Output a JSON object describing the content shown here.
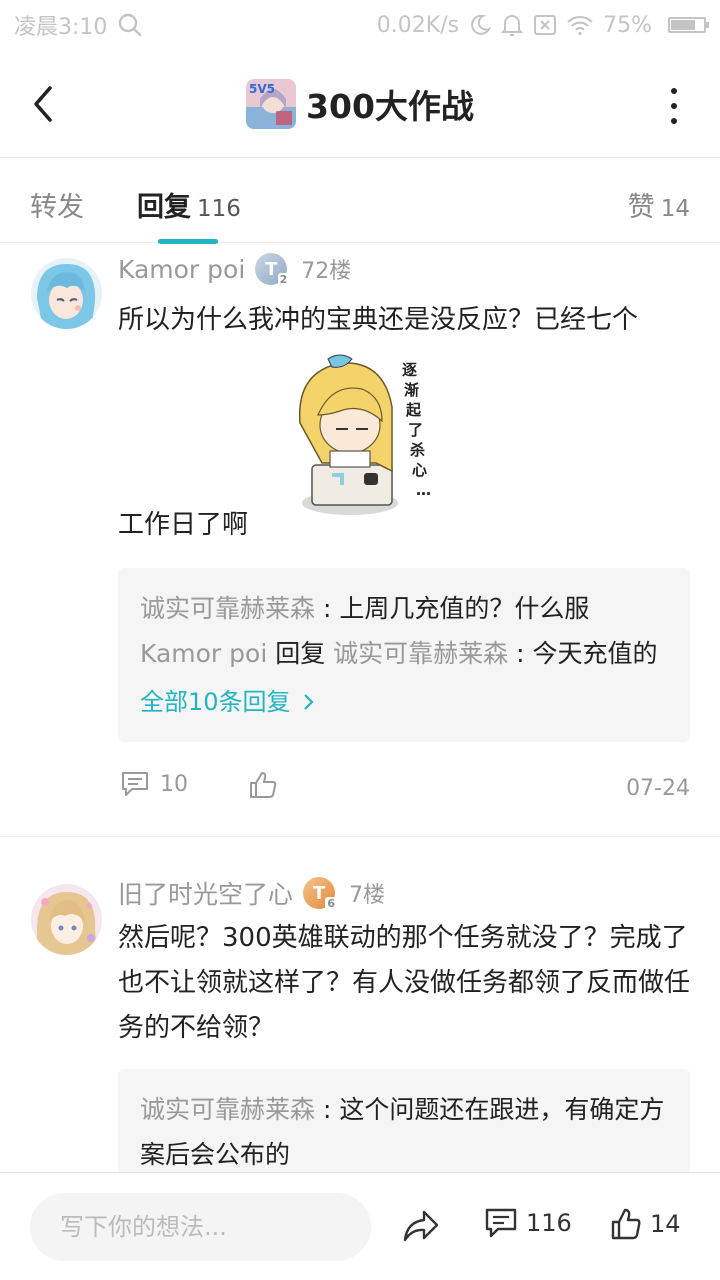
{
  "status_bar": {
    "time": "凌晨3:10",
    "speed": "0.02K/s",
    "battery": "75%",
    "battery_level": 0.75
  },
  "header": {
    "title": "300大作战",
    "game_icon_text": "5V5",
    "icons": [
      "back-arrow-icon",
      "more-vertical-icon"
    ]
  },
  "tabs": {
    "forward_label": "转发",
    "reply_label": "回复",
    "reply_count": "116",
    "like_label": "赞",
    "like_count": "14"
  },
  "comments": [
    {
      "username": "Kamor poi",
      "level_letter": "T",
      "level_num": "2",
      "floor": "72楼",
      "text_before_sticker": "所以为什么我冲的宝典还是没反应？已经七个",
      "text_after_sticker": "工作日了啊",
      "sticker_text": [
        "逐",
        "渐",
        "起",
        "了",
        "杀",
        "心",
        "…"
      ],
      "replies": [
        {
          "user": "诚实可靠赫莱森",
          "sep": " : ",
          "text": "上周几充值的？什么服"
        },
        {
          "user": "Kamor poi",
          "mid": " 回复 ",
          "target": "诚实可靠赫莱森",
          "sep": " : ",
          "text": "今天充值的"
        }
      ],
      "view_all": "全部10条回复",
      "comment_count": "10",
      "date": "07-24"
    },
    {
      "username": "旧了时光空了心",
      "level_letter": "T",
      "level_num": "6",
      "floor": "7楼",
      "text": "然后呢？300英雄联动的那个任务就没了？完成了也不让领就这样了？有人没做任务都领了反而做任务的不给领？",
      "replies": [
        {
          "user": "诚实可靠赫莱森",
          "sep": " : ",
          "text": "这个问题还在跟进，有确定方案后会公布的"
        }
      ]
    }
  ],
  "bottom_bar": {
    "placeholder": "写下你的想法...",
    "comment_count": "116",
    "like_count": "14"
  },
  "colors": {
    "accent": "#21b5c2",
    "muted_text": "#999999",
    "reply_bg": "#f5f5f5"
  }
}
